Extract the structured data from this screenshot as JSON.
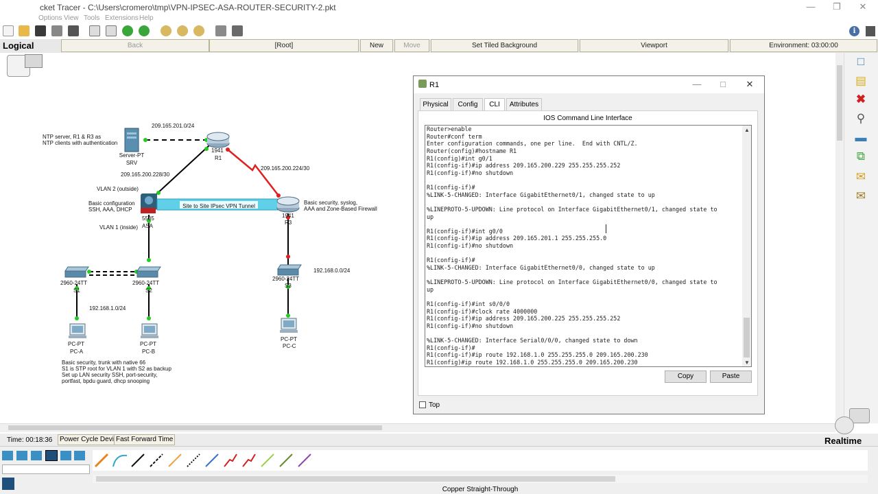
{
  "window": {
    "title": "cket Tracer - C:\\Users\\cromero\\tmp\\VPN-IPSEC-ASA-ROUTER-SECURITY-2.pkt"
  },
  "menu": [
    "Options",
    "View",
    "Tools",
    "Extensions",
    "Help"
  ],
  "nav": {
    "mode": "Logical",
    "back": "Back",
    "root": "[Root]",
    "new_cluster": "New Cluster",
    "move_object": "Move Object",
    "tiled_bg": "Set Tiled Background",
    "viewport": "Viewport",
    "environment": "Environment: 03:00:00"
  },
  "topology": {
    "devices": [
      {
        "label": "Server-PT",
        "name": "SRV"
      },
      {
        "label": "1941",
        "name": "R1"
      },
      {
        "label": "5505",
        "name": "ASA"
      },
      {
        "label": "1941",
        "name": "R3"
      },
      {
        "label": "2960-24TT",
        "name": "S1"
      },
      {
        "label": "2960-24TT",
        "name": "S2"
      },
      {
        "label": "2960-24TT",
        "name": "S3"
      },
      {
        "label": "PC-PT",
        "name": "PC-A"
      },
      {
        "label": "PC-PT",
        "name": "PC-B"
      },
      {
        "label": "PC-PT",
        "name": "PC-C"
      }
    ],
    "notes": {
      "ntp": "NTP server, R1 & R3 as\nNTP clients with authentication",
      "net_201": "209.165.201.0/24",
      "net_228": "209.165.200.228/30",
      "net_224": "209.165.200.224/30",
      "vlan2": "VLAN 2 (outside)",
      "basic_config": "Basic configuration\nSSH, AAA, DHCP",
      "vpn": "Site to Site IPsec VPN Tunnel",
      "r3_security": "Basic security, syslog,\nAAA and Zone-Based Firewall",
      "vlan1": "VLAN 1 (inside)",
      "net_1": "192.168.1.0/24",
      "net_0": "192.168.0.0/24",
      "lan_security": "Basic security, trunk with native 66\nS1 is STP root for VLAN 1 with S2 as backup\nSet up LAN security SSH, port-security,\nportfast, bpdu guard, dhcp snooping"
    }
  },
  "dialog": {
    "title": "R1",
    "tabs": [
      "Physical",
      "Config",
      "CLI",
      "Attributes"
    ],
    "active_tab": "CLI",
    "cli_header": "IOS Command Line Interface",
    "cli_lines": [
      "Router>enable",
      "Router#conf term",
      "Enter configuration commands, one per line.  End with CNTL/Z.",
      "Router(config)#hostname R1",
      "R1(config)#int g0/1",
      "R1(config-if)#ip address 209.165.200.229 255.255.255.252",
      "R1(config-if)#no shutdown",
      "",
      "R1(config-if)#",
      "%LINK-5-CHANGED: Interface GigabitEthernet0/1, changed state to up",
      "",
      "%LINEPROTO-5-UPDOWN: Line protocol on Interface GigabitEthernet0/1, changed state to",
      "up",
      "",
      "R1(config-if)#int g0/0",
      "R1(config-if)#ip address 209.165.201.1 255.255.255.0",
      "R1(config-if)#no shutdown",
      "",
      "R1(config-if)#",
      "%LINK-5-CHANGED: Interface GigabitEthernet0/0, changed state to up",
      "",
      "%LINEPROTO-5-UPDOWN: Line protocol on Interface GigabitEthernet0/0, changed state to",
      "up",
      "",
      "R1(config-if)#int s0/0/0",
      "R1(config-if)#clock rate 4000000",
      "R1(config-if)#ip address 209.165.200.225 255.255.255.252",
      "R1(config-if)#no shutdown",
      "",
      "%LINK-5-CHANGED: Interface Serial0/0/0, changed state to down",
      "R1(config-if)#",
      "R1(config-if)#ip route 192.168.1.0 255.255.255.0 209.165.200.230",
      "R1(config)#ip route 192.168.1.0 255.255.255.0 209.165.200.230"
    ],
    "copy": "Copy",
    "paste": "Paste",
    "top_label": "Top",
    "top_checked": false
  },
  "status": {
    "time": "Time: 00:18:36",
    "power_cycle": "Power Cycle Devices",
    "fast_forward": "Fast Forward Time",
    "mode": "Realtime"
  },
  "bottom": {
    "cable_label": "Copper Straight-Through"
  },
  "colors": {
    "link_red": "#e02020",
    "link_black": "#000000",
    "vpn_bg": "#5fd0e8",
    "port_green": "#22cc22"
  }
}
